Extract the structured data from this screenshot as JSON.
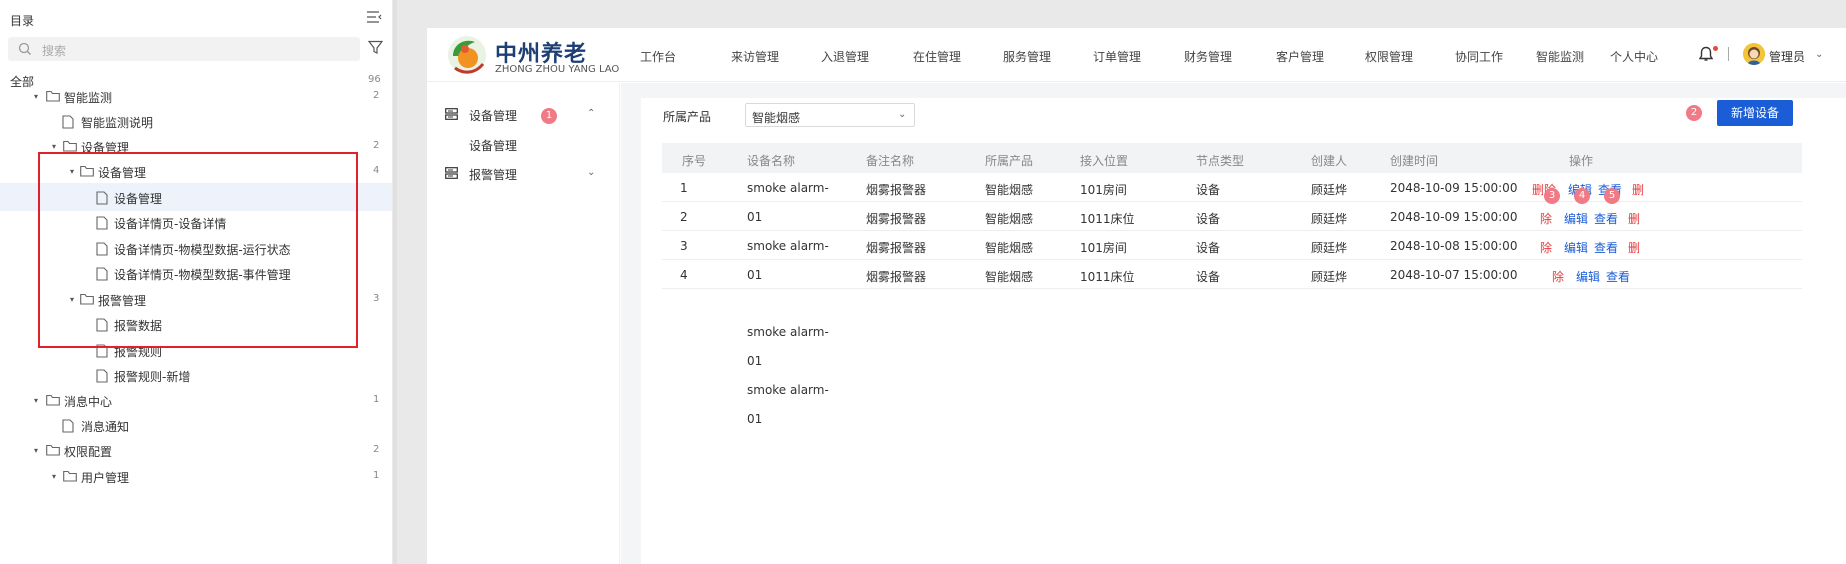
{
  "outline": {
    "title": "目录",
    "search_placeholder": "搜索",
    "all_label": "全部",
    "all_count": "96",
    "items": [
      {
        "label": "智能监测",
        "count": "2"
      },
      {
        "label": "智能监测说明"
      },
      {
        "label": "设备管理",
        "count": "2"
      },
      {
        "label": "设备管理",
        "count": "4"
      },
      {
        "label": "设备管理"
      },
      {
        "label": "设备详情页-设备详情"
      },
      {
        "label": "设备详情页-物模型数据-运行状态"
      },
      {
        "label": "设备详情页-物模型数据-事件管理"
      },
      {
        "label": "报警管理",
        "count": "3"
      },
      {
        "label": "报警数据"
      },
      {
        "label": "报警规则"
      },
      {
        "label": "报警规则-新增"
      },
      {
        "label": "消息中心",
        "count": "1"
      },
      {
        "label": "消息通知"
      },
      {
        "label": "权限配置",
        "count": "2"
      },
      {
        "label": "用户管理",
        "count": "1"
      }
    ]
  },
  "brand": {
    "name_cn": "中州养老",
    "name_en": "ZHONG ZHOU YANG LAO"
  },
  "nav": [
    "工作台",
    "来访管理",
    "入退管理",
    "在住管理",
    "服务管理",
    "订单管理",
    "财务管理",
    "客户管理",
    "权限管理",
    "协同工作",
    "智能监测",
    "个人中心"
  ],
  "user": {
    "name": "管理员"
  },
  "sidemenu": {
    "device_group": "设备管理",
    "device_sub": "设备管理",
    "alarm_group": "报警管理"
  },
  "filter": {
    "label": "所属产品",
    "value": "智能烟感",
    "badge": "1"
  },
  "add_button": {
    "label": "新增设备",
    "badge": "2"
  },
  "table": {
    "headers": [
      "序号",
      "设备名称",
      "备注名称",
      "所属产品",
      "接入位置",
      "节点类型",
      "创建人",
      "创建时间",
      "操作"
    ],
    "action_badges": [
      "3",
      "4",
      "5"
    ],
    "rows": [
      {
        "no": "1",
        "name": "smoke alarm-",
        "remark": "烟雾报警器",
        "product": "智能烟感",
        "location": "101房间",
        "node": "设备",
        "creator": "顾廷烨",
        "time": "2048-10-09 15:00:00",
        "a1": "删除",
        "a2": "编辑",
        "a3": "查看",
        "a4": "删"
      },
      {
        "no": "2",
        "name": "01",
        "remark": "烟雾报警器",
        "product": "智能烟感",
        "location": "1011床位",
        "node": "设备",
        "creator": "顾廷烨",
        "time": "2048-10-09 15:00:00",
        "a1": "除",
        "a2": "编辑",
        "a3": "查看",
        "a4": "删"
      },
      {
        "no": "3",
        "name": "smoke alarm-",
        "remark": "烟雾报警器",
        "product": "智能烟感",
        "location": "101房间",
        "node": "设备",
        "creator": "顾廷烨",
        "time": "2048-10-08 15:00:00",
        "a1": "除",
        "a2": "编辑",
        "a3": "查看",
        "a4": "删"
      },
      {
        "no": "4",
        "name": "01",
        "remark": "烟雾报警器",
        "product": "智能烟感",
        "location": "1011床位",
        "node": "设备",
        "creator": "顾廷烨",
        "time": "2048-10-07 15:00:00",
        "a1": "除",
        "a2": "编辑",
        "a3": "查看",
        "a4": ""
      }
    ],
    "overflow_names": [
      "smoke alarm-",
      "01",
      "smoke alarm-",
      "01"
    ]
  },
  "colors": {
    "accent": "#1a5dd6",
    "danger": "#e4393c",
    "highlight": "#e0202a",
    "badge": "#f07a85"
  }
}
